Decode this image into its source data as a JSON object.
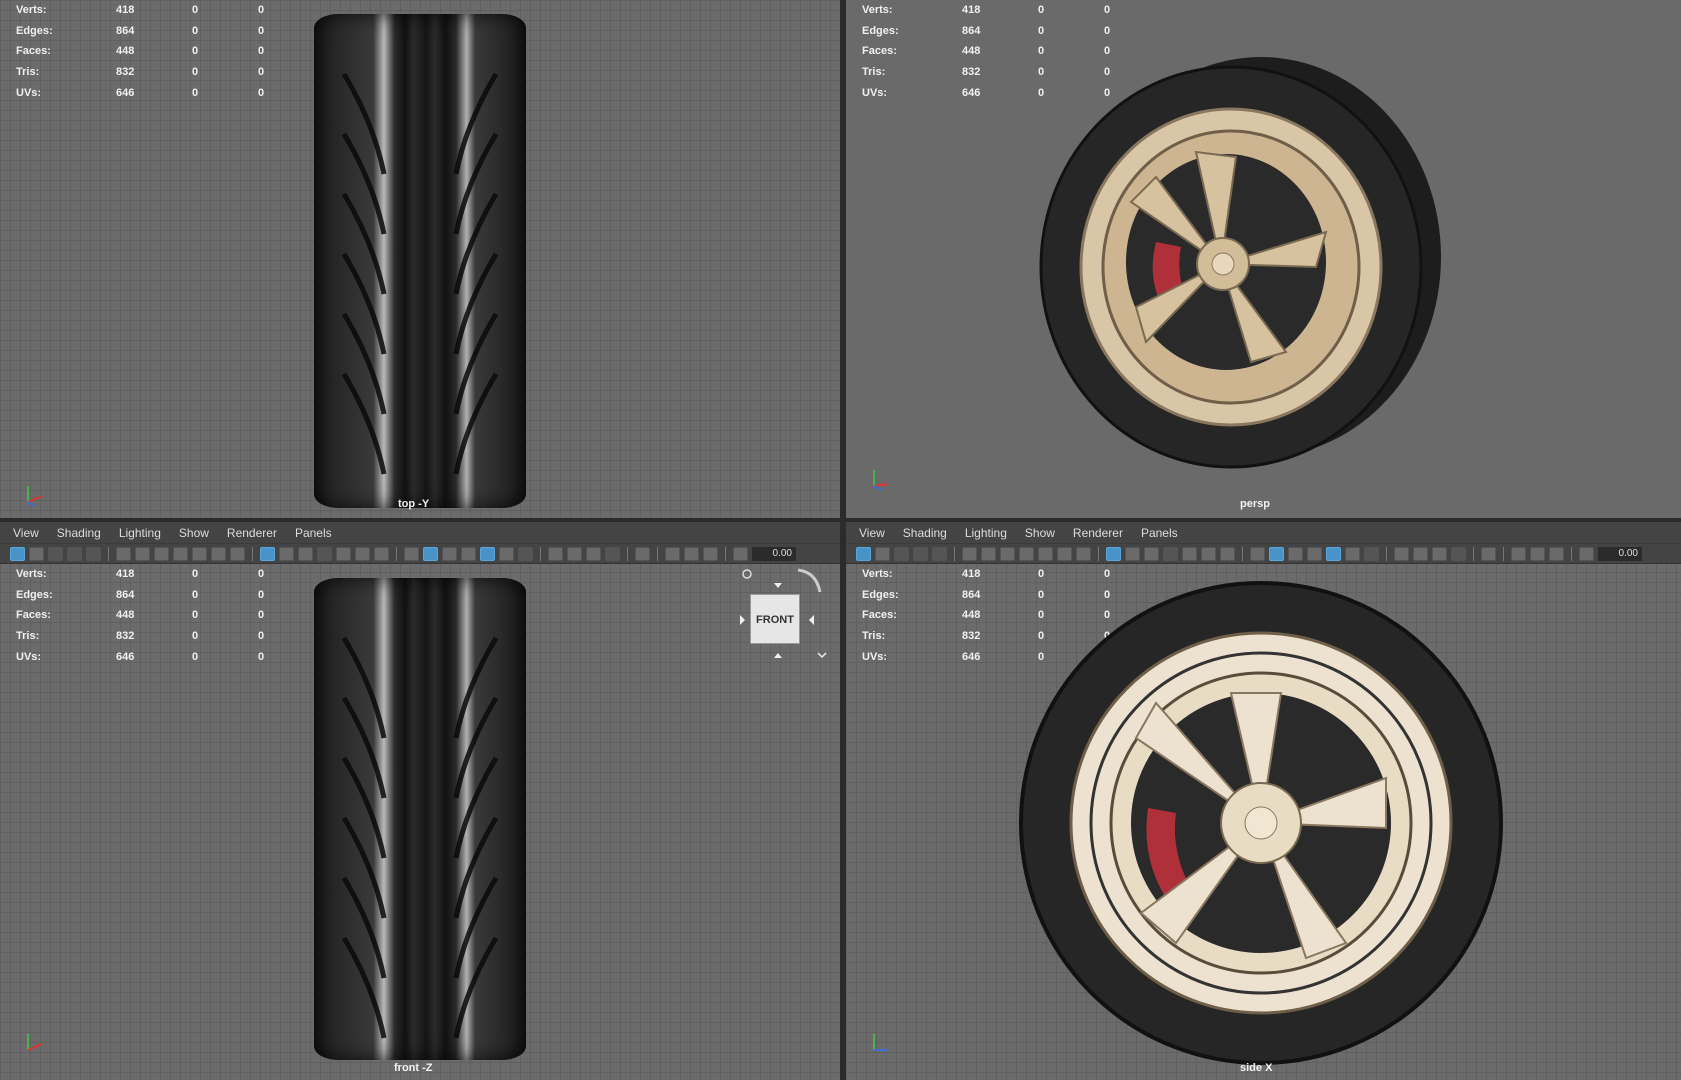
{
  "menu": [
    "View",
    "Shading",
    "Lighting",
    "Show",
    "Renderer",
    "Panels"
  ],
  "toolbar": {
    "value": "0.00"
  },
  "hud": {
    "rows": [
      {
        "label": "Verts:",
        "v1": "418",
        "v2": "0",
        "v3": "0"
      },
      {
        "label": "Edges:",
        "v1": "864",
        "v2": "0",
        "v3": "0"
      },
      {
        "label": "Faces:",
        "v1": "448",
        "v2": "0",
        "v3": "0"
      },
      {
        "label": "Tris:",
        "v1": "832",
        "v2": "0",
        "v3": "0"
      },
      {
        "label": "UVs:",
        "v1": "646",
        "v2": "0",
        "v3": "0"
      }
    ]
  },
  "panels": {
    "top": {
      "camera": "top -Y"
    },
    "persp": {
      "camera": "persp"
    },
    "front": {
      "camera": "front -Z"
    },
    "side": {
      "camera": "side X"
    }
  },
  "viewcube": {
    "face": "FRONT"
  },
  "colors": {
    "viewport": "#6b6b6b",
    "accent": "#4a93c9",
    "rim": "#d9c6a6",
    "caliper": "#b0303a"
  }
}
